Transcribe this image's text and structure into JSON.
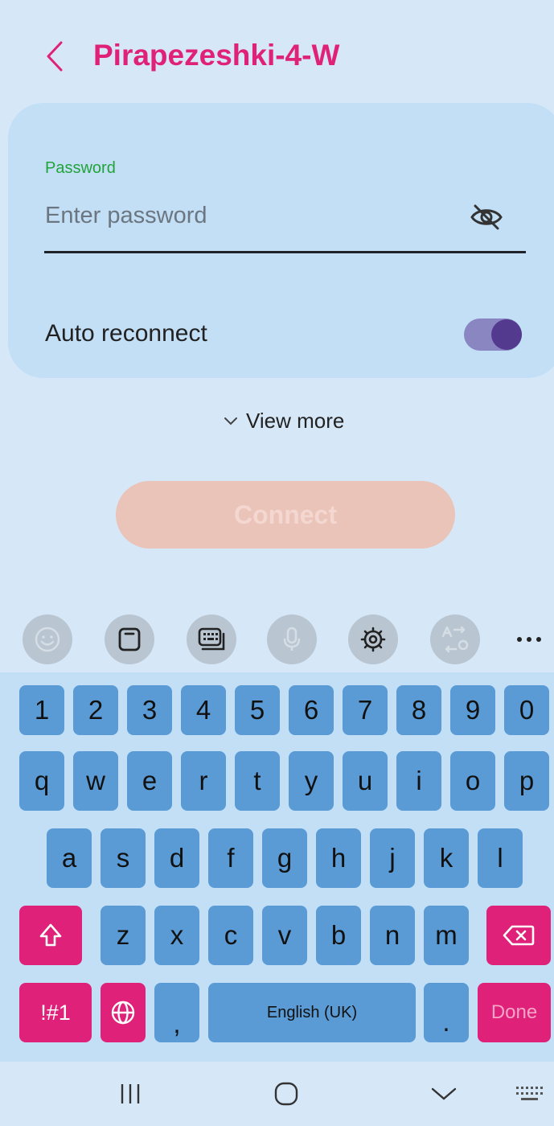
{
  "header": {
    "back_icon": "chevron-left-icon",
    "title": "Pirapezeshki-4-W"
  },
  "password": {
    "label": "Password",
    "placeholder": "Enter password",
    "value": "",
    "visibility_icon": "eye-off-icon"
  },
  "auto_reconnect": {
    "label": "Auto reconnect",
    "enabled": true
  },
  "view_more": {
    "label": "View more",
    "icon": "chevron-down-icon"
  },
  "connect": {
    "label": "Connect",
    "enabled": false
  },
  "keyboard": {
    "toolbar": [
      "emoji-icon",
      "clipboard-icon",
      "keyboard-mode-icon",
      "microphone-icon",
      "settings-icon",
      "translate-icon",
      "more-icon"
    ],
    "row_numbers": [
      "1",
      "2",
      "3",
      "4",
      "5",
      "6",
      "7",
      "8",
      "9",
      "0"
    ],
    "row_1": [
      "q",
      "w",
      "e",
      "r",
      "t",
      "y",
      "u",
      "i",
      "o",
      "p"
    ],
    "row_2": [
      "a",
      "s",
      "d",
      "f",
      "g",
      "h",
      "j",
      "k",
      "l"
    ],
    "row_3": [
      "z",
      "x",
      "c",
      "v",
      "b",
      "n",
      "m"
    ],
    "symbols_label": "!#1",
    "comma": ",",
    "space_label": "English (UK)",
    "period": ".",
    "done_label": "Done"
  },
  "navbar": [
    "recent-apps-icon",
    "home-icon",
    "back-icon",
    "keyboard-switch-icon"
  ],
  "colors": {
    "accent": "#e0217a",
    "label_green": "#22a33a",
    "key_blue": "#5a9bd6",
    "background": "#d6e8f8",
    "card": "#c2dff6"
  }
}
